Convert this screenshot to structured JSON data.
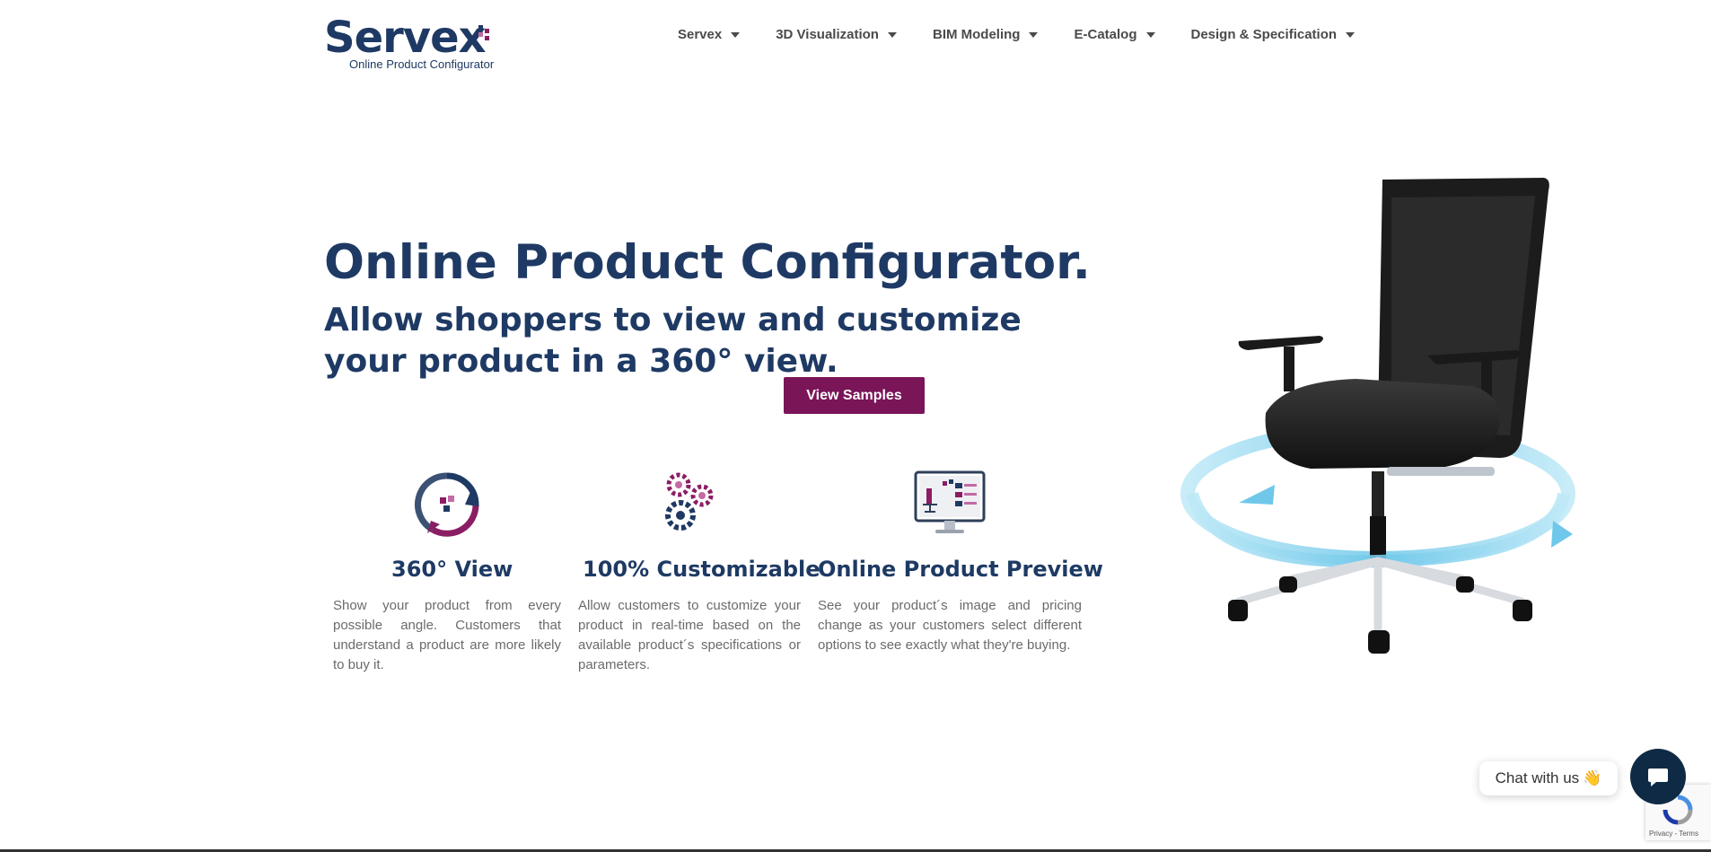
{
  "logo": {
    "brand": "Servex",
    "tagline": "Online Product Configurator"
  },
  "nav": {
    "items": [
      {
        "label": "Servex"
      },
      {
        "label": "3D Visualization"
      },
      {
        "label": "BIM Modeling"
      },
      {
        "label": "E-Catalog"
      },
      {
        "label": "Design & Specification"
      }
    ]
  },
  "hero": {
    "title": "Online Product Configurator.",
    "subtitle": "Allow shoppers to view and customize your product in a 360° view.",
    "cta_label": "View Samples"
  },
  "features": [
    {
      "icon": "rotate-360-icon",
      "title": "360° View",
      "text": "Show your product from every possible angle. Customers that understand a product are more likely to buy it."
    },
    {
      "icon": "gears-icon",
      "title": "100% Customizable",
      "text": "Allow customers to customize your product in real-time based on the available product´s specifications or parameters."
    },
    {
      "icon": "monitor-preview-icon",
      "title": "Online Product Preview",
      "text": "See your product´s image and pricing change as your customers select different options to see exactly what they're buying."
    }
  ],
  "chat": {
    "label": "Chat with us",
    "emoji": "👋"
  },
  "recaptcha": {
    "terms": "Privacy - Terms"
  },
  "colors": {
    "brand_navy": "#1e3a64",
    "accent_plum": "#7a1558",
    "chat_navy": "#0f2a44"
  }
}
